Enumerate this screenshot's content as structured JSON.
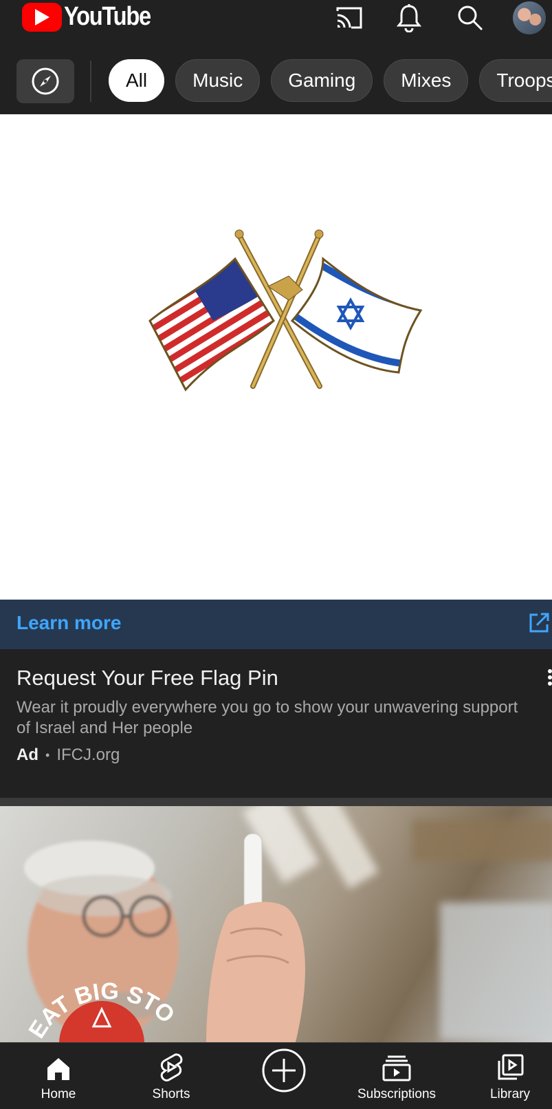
{
  "header": {
    "logo_text": "YouTube",
    "icons": [
      "cast-icon",
      "bell-icon",
      "search-icon",
      "avatar"
    ]
  },
  "chips": {
    "explore_icon": "compass-icon",
    "items": [
      {
        "label": "All",
        "active": true
      },
      {
        "label": "Music",
        "active": false
      },
      {
        "label": "Gaming",
        "active": false
      },
      {
        "label": "Mixes",
        "active": false
      },
      {
        "label": "Troops",
        "active": false
      }
    ]
  },
  "ad": {
    "learn_more": "Learn more",
    "title": "Request Your Free Flag Pin",
    "description": "Wear it proudly everywhere you go to show your unwavering support of Israel and Her people",
    "badge": "Ad",
    "separator": "•",
    "advertiser": "IFCJ.org"
  },
  "video": {
    "thumbnail_text": "EAT BIG STO"
  },
  "bottom_nav": [
    {
      "label": "Home",
      "icon": "home-icon"
    },
    {
      "label": "Shorts",
      "icon": "shorts-icon"
    },
    {
      "label": "",
      "icon": "create-icon"
    },
    {
      "label": "Subscriptions",
      "icon": "subscriptions-icon"
    },
    {
      "label": "Library",
      "icon": "library-icon"
    }
  ],
  "colors": {
    "background": "#212121",
    "accent_link": "#3ea6ff",
    "learn_bar": "#263850",
    "brand_red": "#ff0000"
  }
}
